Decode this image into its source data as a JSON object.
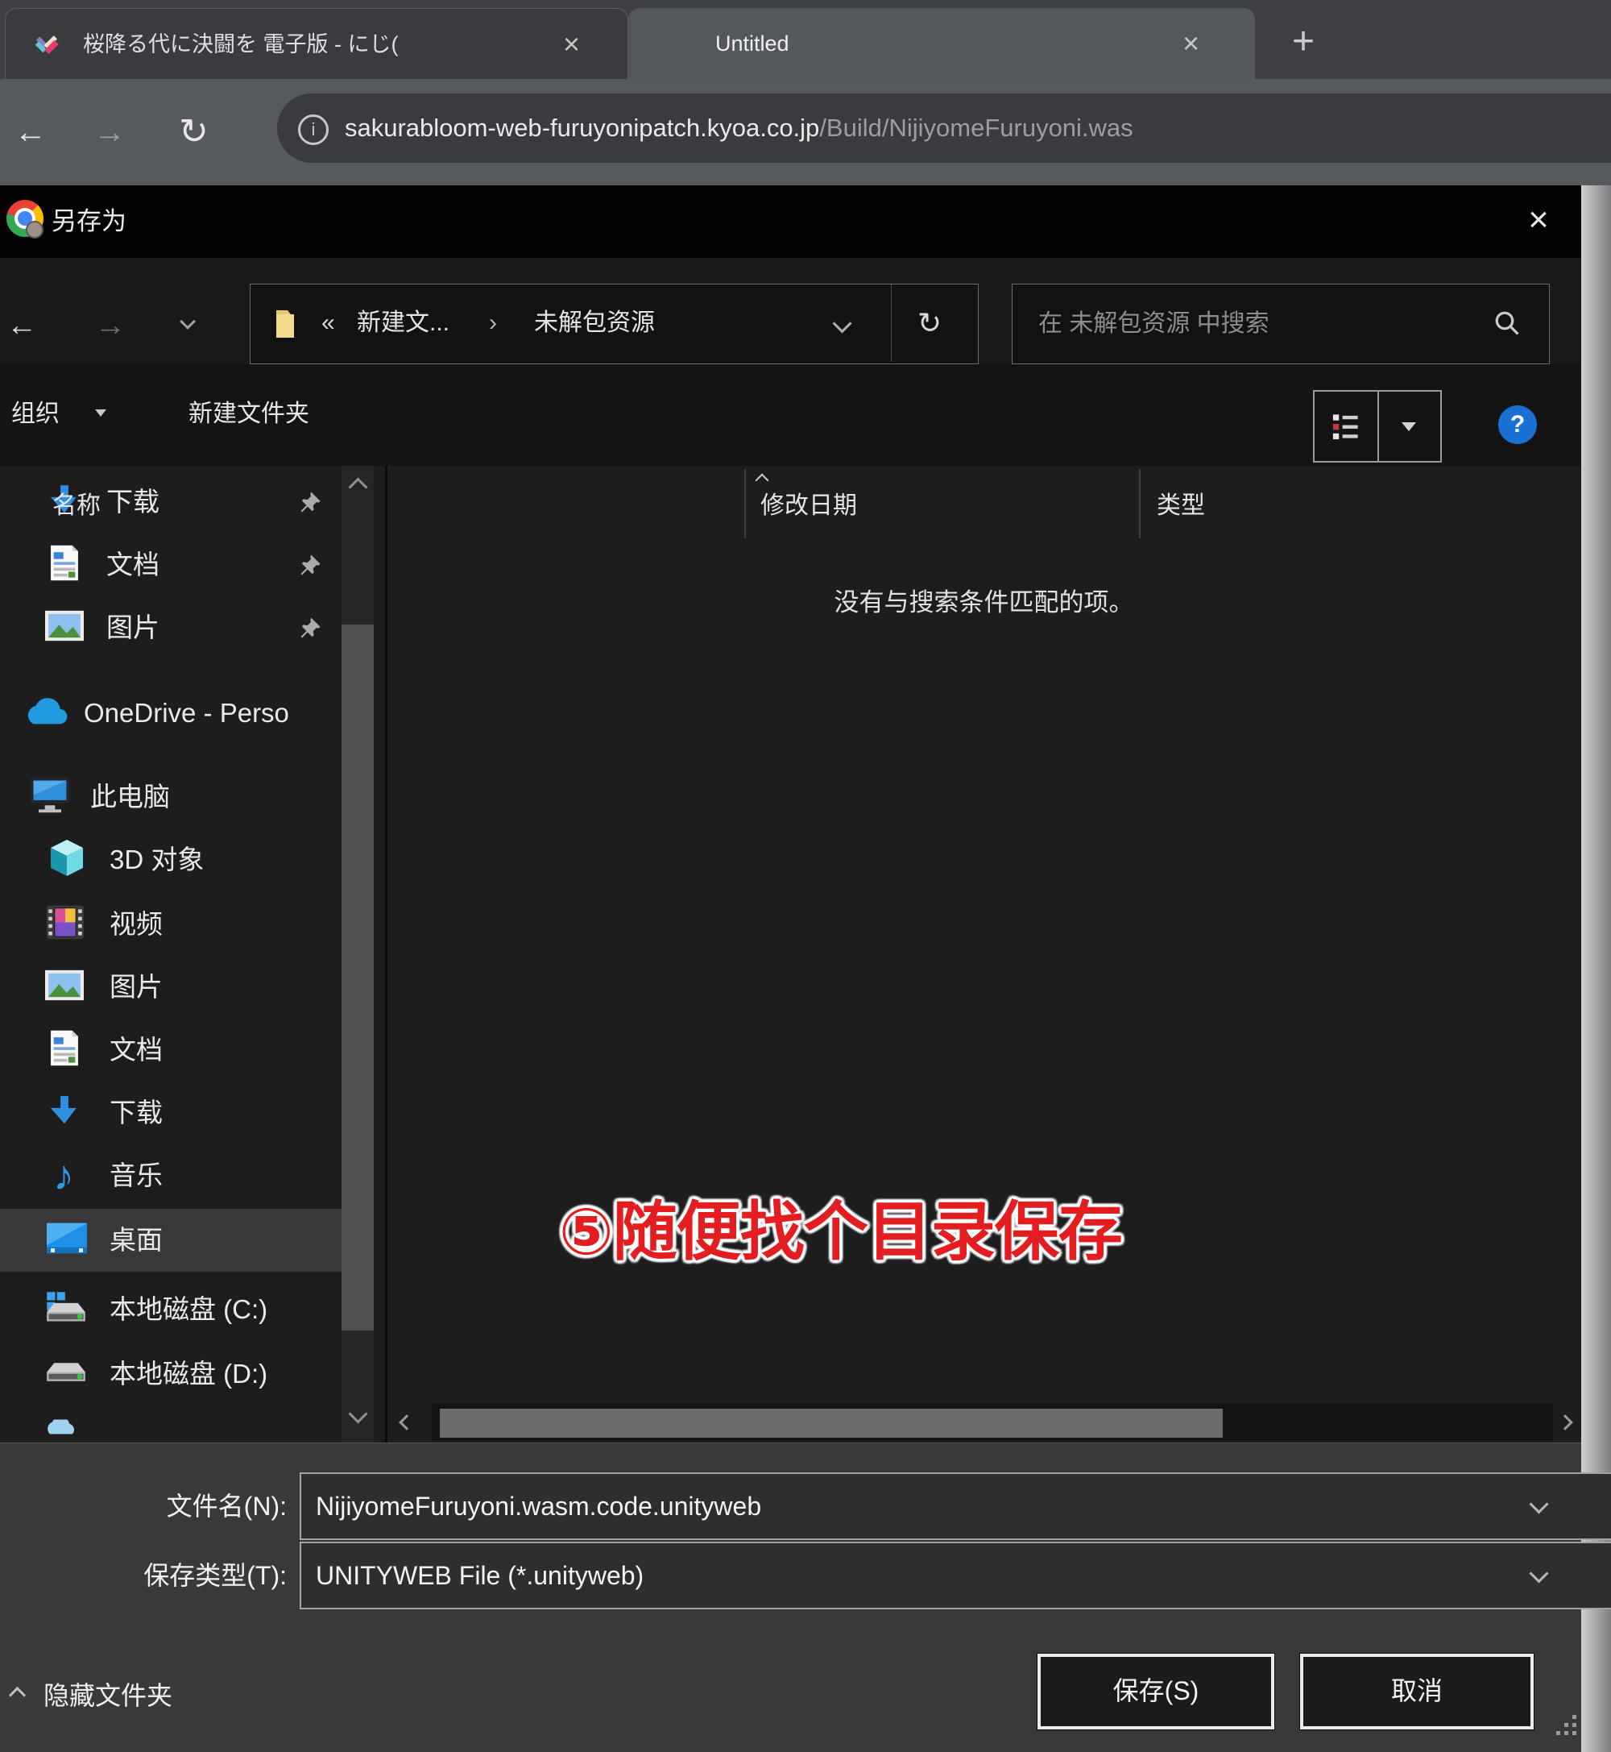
{
  "colors": {
    "help_blue": "#1a71d3",
    "annotation_red": "#e41d20",
    "accent_blue": "#2f8fe0"
  },
  "browser": {
    "tabs": [
      {
        "title": "桜降る代に決闘を 電子版 - にじ("
      },
      {
        "title": "Untitled"
      }
    ],
    "icons": {
      "close": "×",
      "new_tab": "+",
      "back": "←",
      "forward": "→",
      "reload": "↻",
      "info": "i"
    },
    "url": {
      "domain": "sakurabloom-web-furuyonipatch.kyoa.co.jp",
      "path": "/Build/NijiyomeFuruyoni.was"
    }
  },
  "dialog": {
    "title": "另存为",
    "icons": {
      "close": "×",
      "back": "←",
      "forward": "→",
      "up": "↑",
      "refresh": "↻",
      "guillemet": "«",
      "crumb_sep": "›",
      "help": "?",
      "music": "♪"
    },
    "breadcrumb": {
      "folder_crumb": "新建文...",
      "current": "未解包资源"
    },
    "search": {
      "placeholder": "在 未解包资源 中搜索"
    },
    "toolbar": {
      "organize": "组织",
      "new_folder": "新建文件夹"
    },
    "sidebar": [
      {
        "label": "下载"
      },
      {
        "label": "文档"
      },
      {
        "label": "图片"
      },
      {
        "label": "OneDrive - Perso"
      },
      {
        "label": "此电脑"
      },
      {
        "label": "3D 对象"
      },
      {
        "label": "视频"
      },
      {
        "label": "图片"
      },
      {
        "label": "文档"
      },
      {
        "label": "下载"
      },
      {
        "label": "音乐"
      },
      {
        "label": "桌面"
      },
      {
        "label": "本地磁盘 (C:)"
      },
      {
        "label": "本地磁盘 (D:)"
      }
    ],
    "main": {
      "columns": [
        "名称",
        "修改日期",
        "类型"
      ],
      "empty_text": "没有与搜索条件匹配的项。",
      "annotation": "⑤随便找个目录保存"
    },
    "footer": {
      "filename_label": "文件名(N):",
      "filename_value": "NijiyomeFuruyoni.wasm.code.unityweb",
      "type_label": "保存类型(T):",
      "type_value": "UNITYWEB File (*.unityweb)",
      "hide_folders": "隐藏文件夹",
      "save": "保存(S)",
      "cancel": "取消"
    }
  }
}
